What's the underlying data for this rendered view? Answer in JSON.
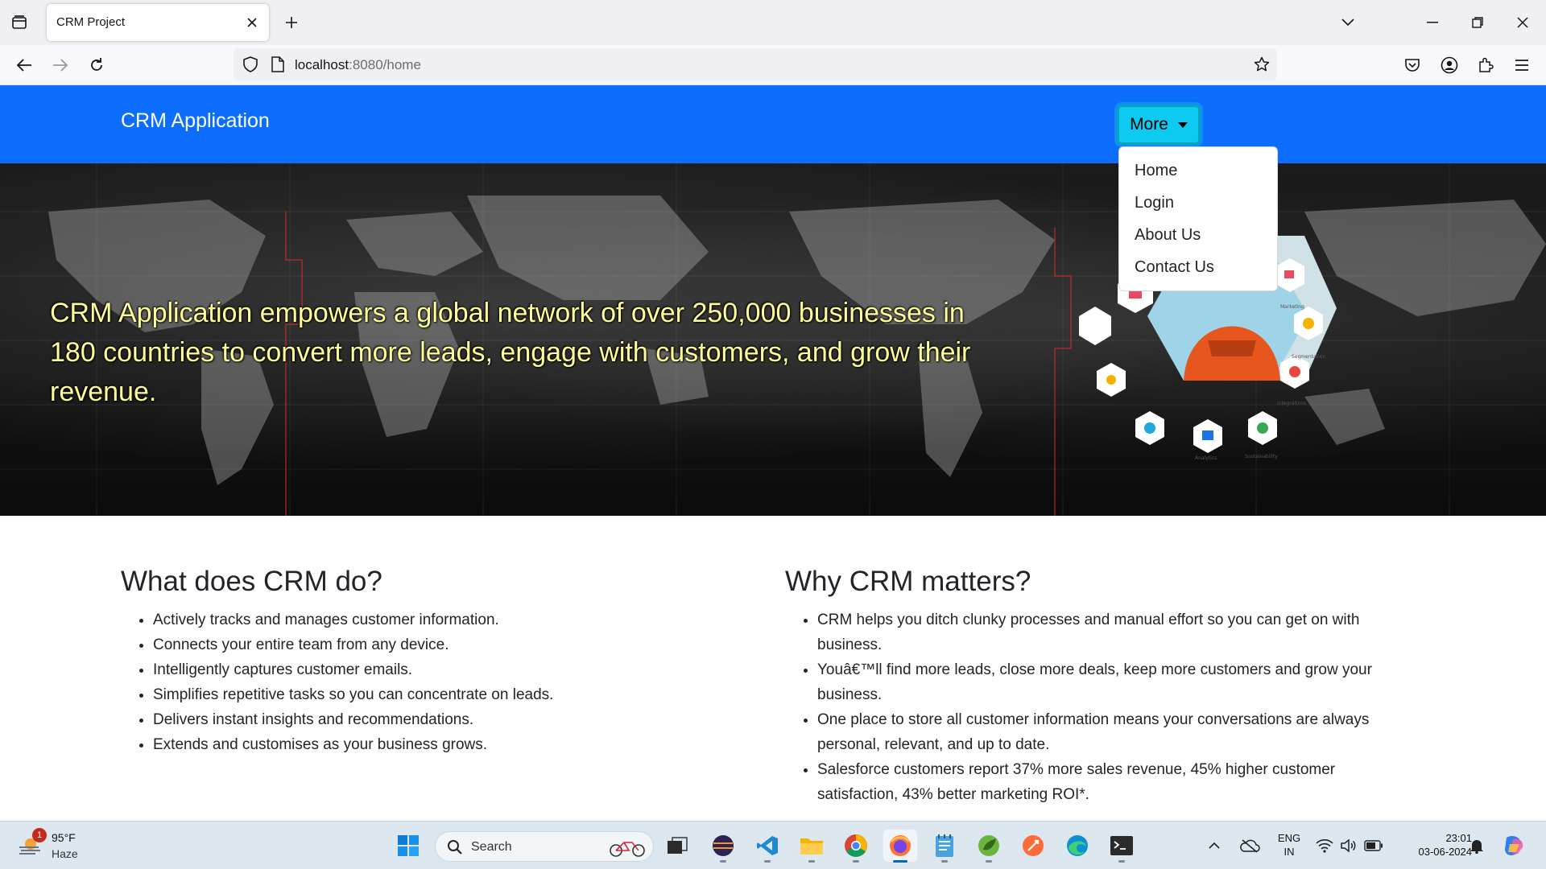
{
  "browser": {
    "tab_title": "CRM Project",
    "url_host": "localhost",
    "url_rest": ":8080/home"
  },
  "page": {
    "brand": "CRM Application",
    "more_button": "More",
    "dropdown_items": [
      "Home",
      "Login",
      "About Us",
      "Contact Us"
    ],
    "hero_text": "CRM Application empowers a global network of over 250,000 businesses in 180 countries to convert more leads, engage with customers, and grow their revenue.",
    "left_section": {
      "heading": "What does CRM do?",
      "items": [
        "Actively tracks and manages customer information.",
        "Connects your entire team from any device.",
        "Intelligently captures customer emails.",
        "Simplifies repetitive tasks so you can concentrate on leads.",
        "Delivers instant insights and recommendations.",
        "Extends and customises as your business grows."
      ]
    },
    "right_section": {
      "heading": "Why CRM matters?",
      "items": [
        "CRM helps you ditch clunky processes and manual effort so you can get on with business.",
        "Youâ€™ll find more leads, close more deals, keep more customers and grow your business.",
        "One place to store all customer information means your conversations are always personal, relevant, and up to date.",
        "Salesforce customers report 37% more sales revenue, 45% higher customer satisfaction, 43% better marketing ROI*."
      ]
    },
    "hero_graphic_labels": [
      "Marketing",
      "Segmentation",
      "Integrations",
      "Sustainability",
      "Analytics"
    ]
  },
  "taskbar": {
    "weather_badge": "1",
    "weather_temp": "95°F",
    "weather_condition": "Haze",
    "search_label": "Search",
    "lang_line1": "ENG",
    "lang_line2": "IN",
    "time": "23:01",
    "date": "03-06-2024"
  },
  "colors": {
    "navbar": "#0d6efd",
    "more_button": "#0dcaf0",
    "hero_text": "#ffff99"
  }
}
